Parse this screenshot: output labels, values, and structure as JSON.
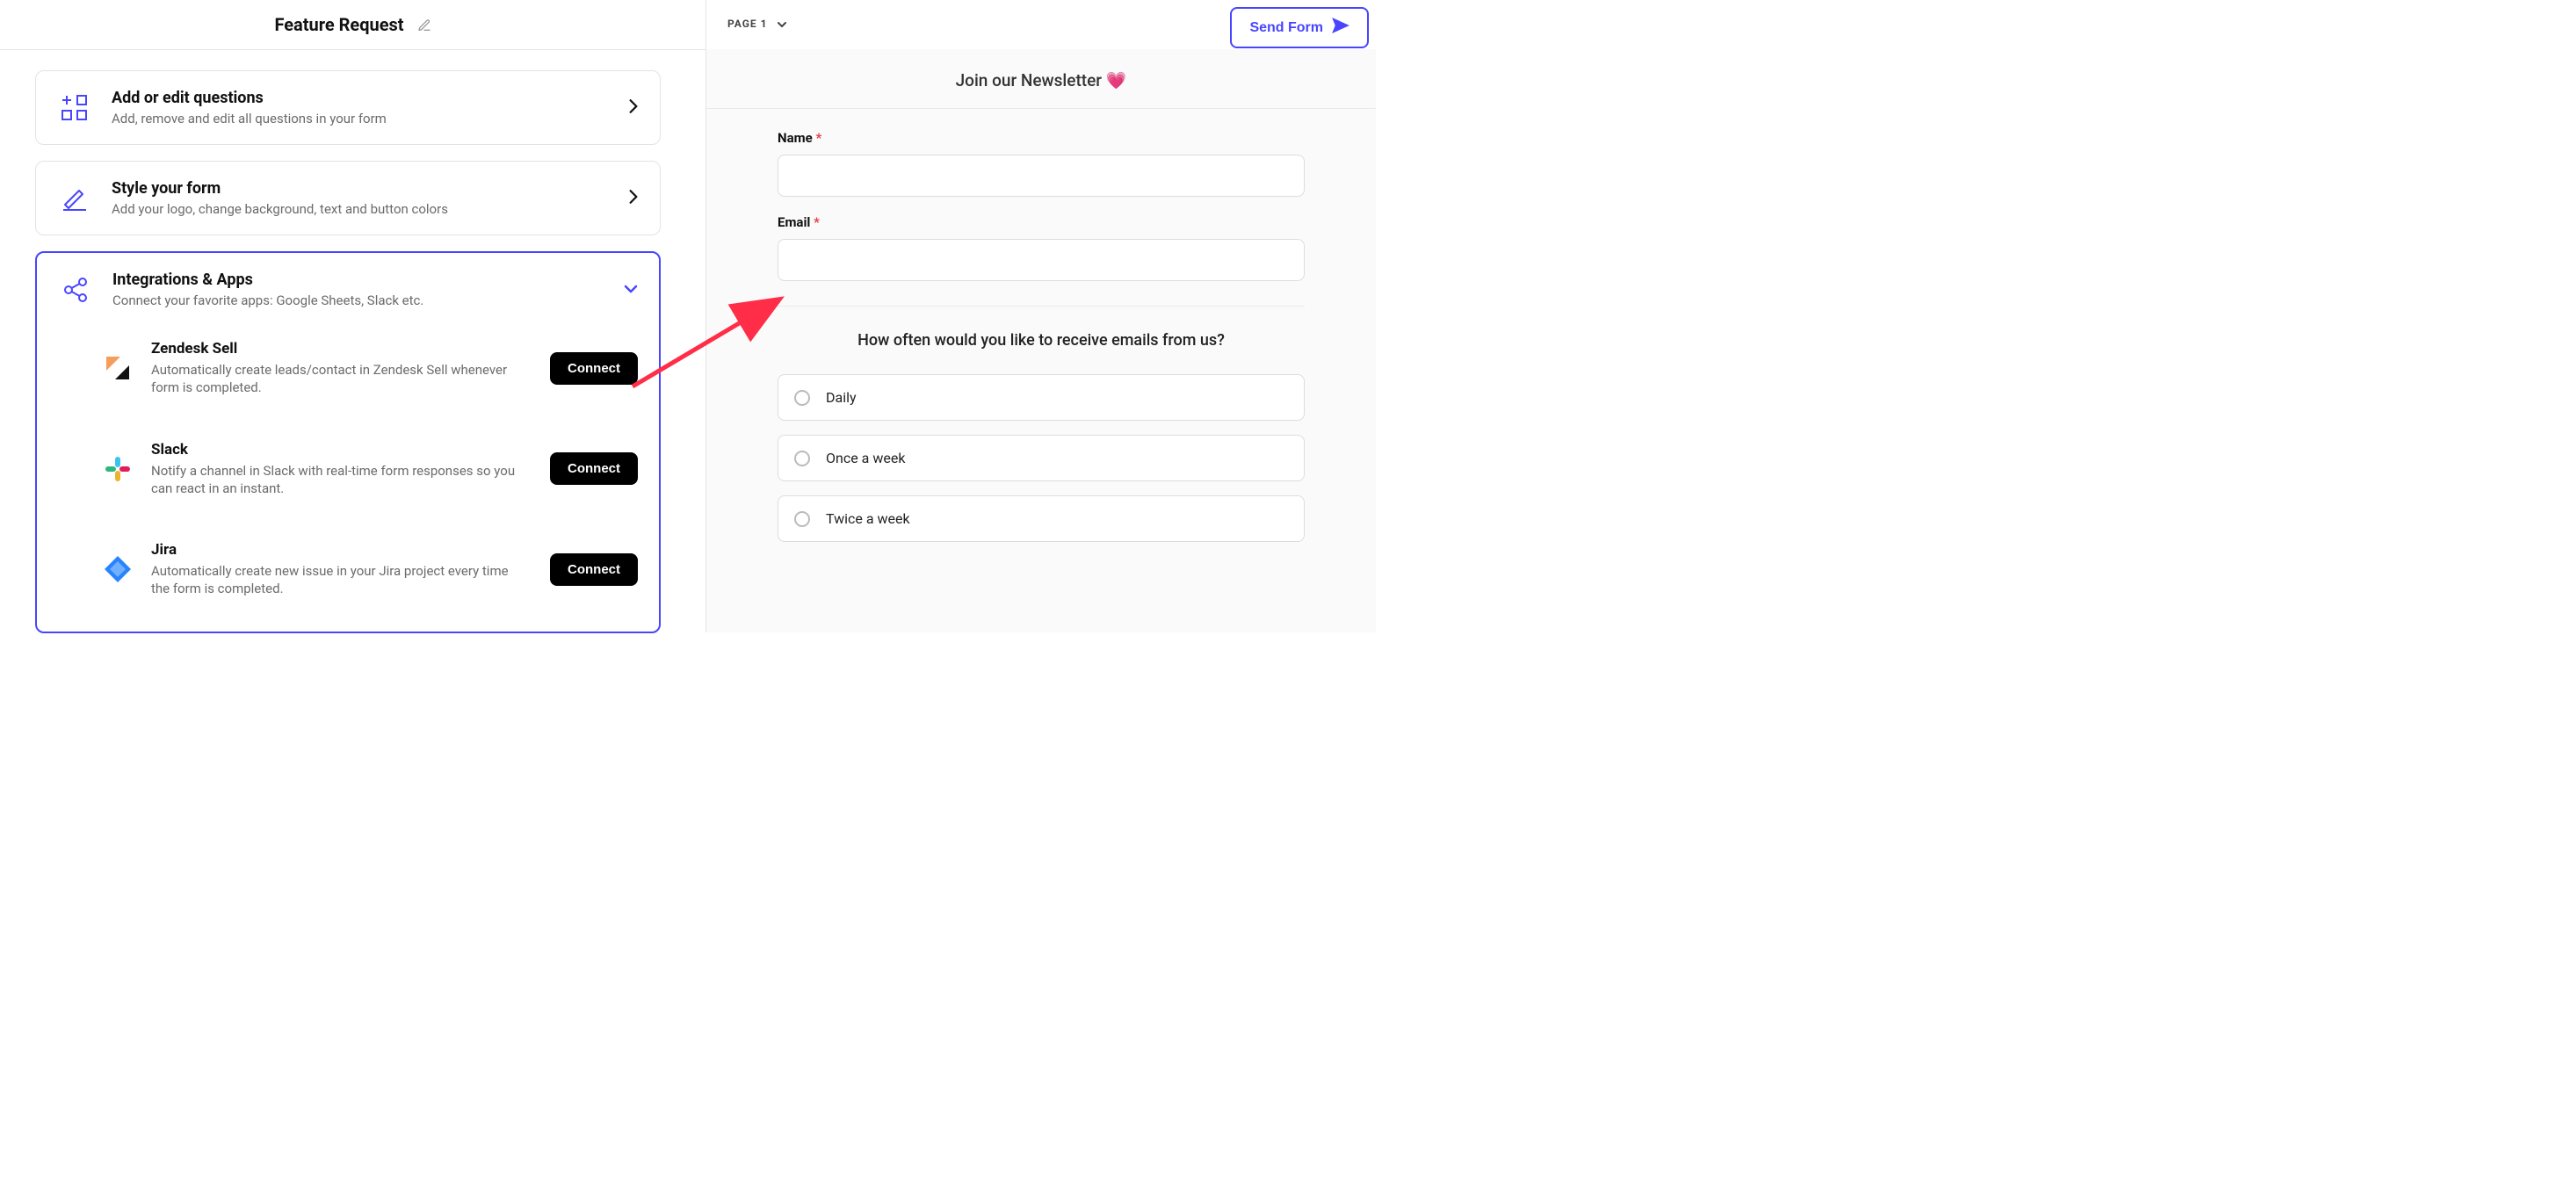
{
  "header": {
    "form_name": "Feature Request",
    "page_label": "PAGE 1",
    "send_button": "Send Form"
  },
  "left": {
    "cards": {
      "questions": {
        "title": "Add or edit questions",
        "subtitle": "Add, remove and edit all questions in your form"
      },
      "style": {
        "title": "Style your form",
        "subtitle": "Add your logo, change background, text and button colors"
      },
      "integrations": {
        "title": "Integrations & Apps",
        "subtitle": "Connect your favorite apps: Google Sheets, Slack etc."
      }
    },
    "connect_label": "Connect",
    "integrations": [
      {
        "name": "Zendesk Sell",
        "desc": "Automatically create leads/contact in Zendesk Sell whenever form is completed."
      },
      {
        "name": "Slack",
        "desc": "Notify a channel in Slack with real-time form responses so you can react in an instant."
      },
      {
        "name": "Jira",
        "desc": "Automatically create new issue in your Jira project every time the form is completed."
      }
    ]
  },
  "preview": {
    "title": "Join our Newsletter 💗",
    "fields": {
      "name_label": "Name",
      "email_label": "Email"
    },
    "question": "How often would you like to receive emails from us?",
    "options": [
      "Daily",
      "Once a week",
      "Twice a week"
    ]
  }
}
